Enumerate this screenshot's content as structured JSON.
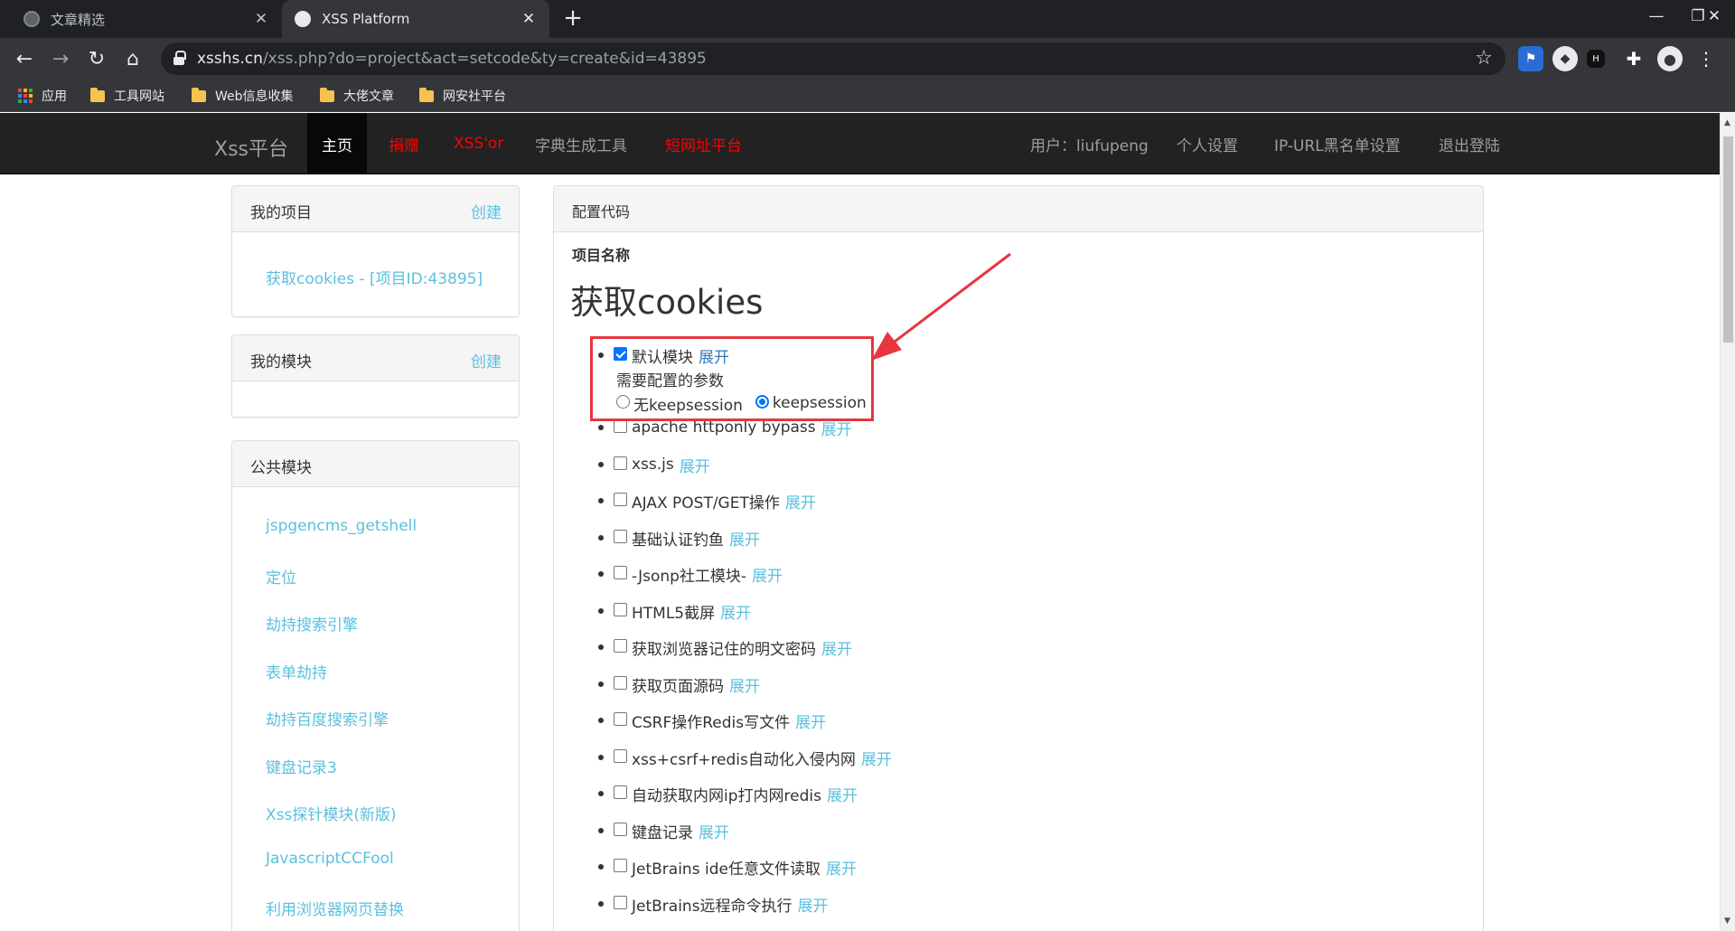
{
  "browser": {
    "tabs": [
      {
        "title": "文章精选",
        "active": false
      },
      {
        "title": "XSS Platform",
        "active": true
      }
    ],
    "new_tab": "+",
    "url_host": "xsshs.cn",
    "url_path": "/xss.php?do=project&act=setcode&ty=create&id=43895",
    "bookmarks": [
      {
        "label": "应用",
        "icon": "apps-grid-icon"
      },
      {
        "label": "工具网站",
        "icon": "folder-icon"
      },
      {
        "label": "Web信息收集",
        "icon": "folder-icon"
      },
      {
        "label": "大佬文章",
        "icon": "folder-icon"
      },
      {
        "label": "网安社平台",
        "icon": "folder-icon"
      }
    ],
    "extension_icons": [
      "bookmark-ext-icon",
      "fox-ext-icon",
      "dark-ext-icon",
      "puzzle-icon",
      "profile-icon",
      "menu-kebab-icon"
    ]
  },
  "navbar": {
    "brand": "Xss平台",
    "left_items": [
      {
        "label": "主页",
        "active": true,
        "color": "#ffffff"
      },
      {
        "label": "捐赠",
        "color": "#ff0000"
      },
      {
        "label": "XSS'or",
        "color": "#ff0000"
      },
      {
        "label": "字典生成工具",
        "color": "#9d9d9d"
      },
      {
        "label": "短网址平台",
        "color": "#ff0000"
      }
    ],
    "right_items": [
      {
        "label": "用户：liufupeng"
      },
      {
        "label": "个人设置"
      },
      {
        "label": "IP-URL黑名单设置"
      },
      {
        "label": "退出登陆"
      }
    ]
  },
  "sidebar": {
    "my_projects": {
      "title": "我的项目",
      "action": "创建",
      "items": [
        "获取cookies - [项目ID:43895]"
      ]
    },
    "my_modules": {
      "title": "我的模块",
      "action": "创建",
      "items": []
    },
    "public_modules": {
      "title": "公共模块",
      "items": [
        "jspgencms_getshell",
        "定位",
        "劫持搜索引擎",
        "表单劫持",
        "劫持百度搜索引擎",
        "键盘记录3",
        "Xss探针模块(新版)",
        "JavascriptCCFool",
        "利用浏览器网页替换"
      ]
    }
  },
  "main": {
    "heading": "配置代码",
    "project_label": "项目名称",
    "project_name": "获取cookies",
    "default_module": {
      "name": "默认模块",
      "expand": "展开",
      "checked": true,
      "params_label": "需要配置的参数",
      "options": [
        {
          "label": "无keepsession",
          "selected": false
        },
        {
          "label": "keepsession",
          "selected": true
        }
      ]
    },
    "modules": [
      {
        "name": "apache httponly bypass",
        "expand": "展开",
        "checked": false
      },
      {
        "name": "xss.js",
        "expand": "展开",
        "checked": false
      },
      {
        "name": "AJAX POST/GET操作",
        "expand": "展开",
        "checked": false
      },
      {
        "name": "基础认证钓鱼",
        "expand": "展开",
        "checked": false
      },
      {
        "name": "-Jsonp社工模块-",
        "expand": "展开",
        "checked": false
      },
      {
        "name": "HTML5截屏",
        "expand": "展开",
        "checked": false
      },
      {
        "name": "获取浏览器记住的明文密码",
        "expand": "展开",
        "checked": false
      },
      {
        "name": "获取页面源码",
        "expand": "展开",
        "checked": false
      },
      {
        "name": "CSRF操作Redis写文件",
        "expand": "展开",
        "checked": false
      },
      {
        "name": "xss+csrf+redis自动化入侵内网",
        "expand": "展开",
        "checked": false
      },
      {
        "name": "自动获取内网ip打内网redis",
        "expand": "展开",
        "checked": false
      },
      {
        "name": "键盘记录",
        "expand": "展开",
        "checked": false
      },
      {
        "name": "JetBrains ide任意文件读取",
        "expand": "展开",
        "checked": false
      },
      {
        "name": "JetBrains远程命令执行",
        "expand": "展开",
        "checked": false
      }
    ]
  },
  "colors": {
    "link": "#5bc0de",
    "link_dark": "#337ab7",
    "highlight_box": "#e8353e",
    "navbar_bg": "#222222",
    "accent_blue": "#0075ff"
  }
}
